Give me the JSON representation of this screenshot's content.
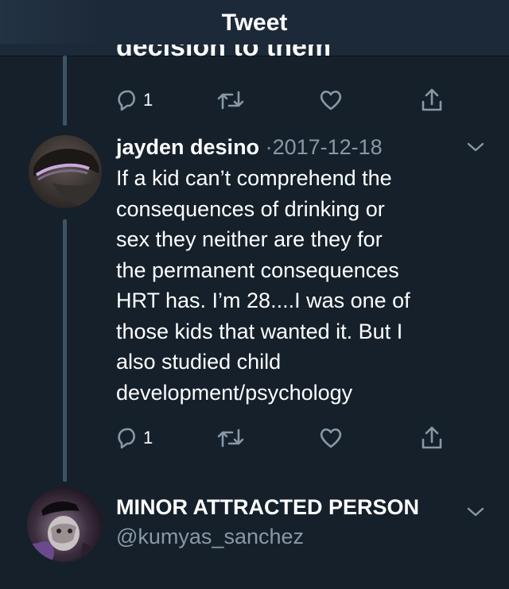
{
  "header": {
    "title": "Tweet"
  },
  "previous_tweet": {
    "cut_text": "decision to them",
    "reply_count": "1"
  },
  "reply_tweet": {
    "author_name": "jayden desino",
    "separator": "·",
    "date": "2017-12-18",
    "text_lines": [
      "If a kid can’t comprehend the",
      "consequences of drinking or",
      "sex they neither are they for",
      "the permanent consequences",
      "HRT has. I’m 28....I was one of",
      "those kids that wanted it. But I",
      "also studied child",
      "development/psychology"
    ],
    "reply_count": "1"
  },
  "next_tweet": {
    "author_name": "MINOR ATTRACTED PERSON",
    "handle": "@kumyas_sanchez"
  },
  "colors": {
    "background": "#15202b",
    "header": "#1c2938",
    "secondary_text": "#8899a6",
    "thread_line": "#3d5466"
  },
  "icons": [
    "reply-icon",
    "retweet-icon",
    "like-icon",
    "share-icon",
    "chevron-down-icon"
  ]
}
